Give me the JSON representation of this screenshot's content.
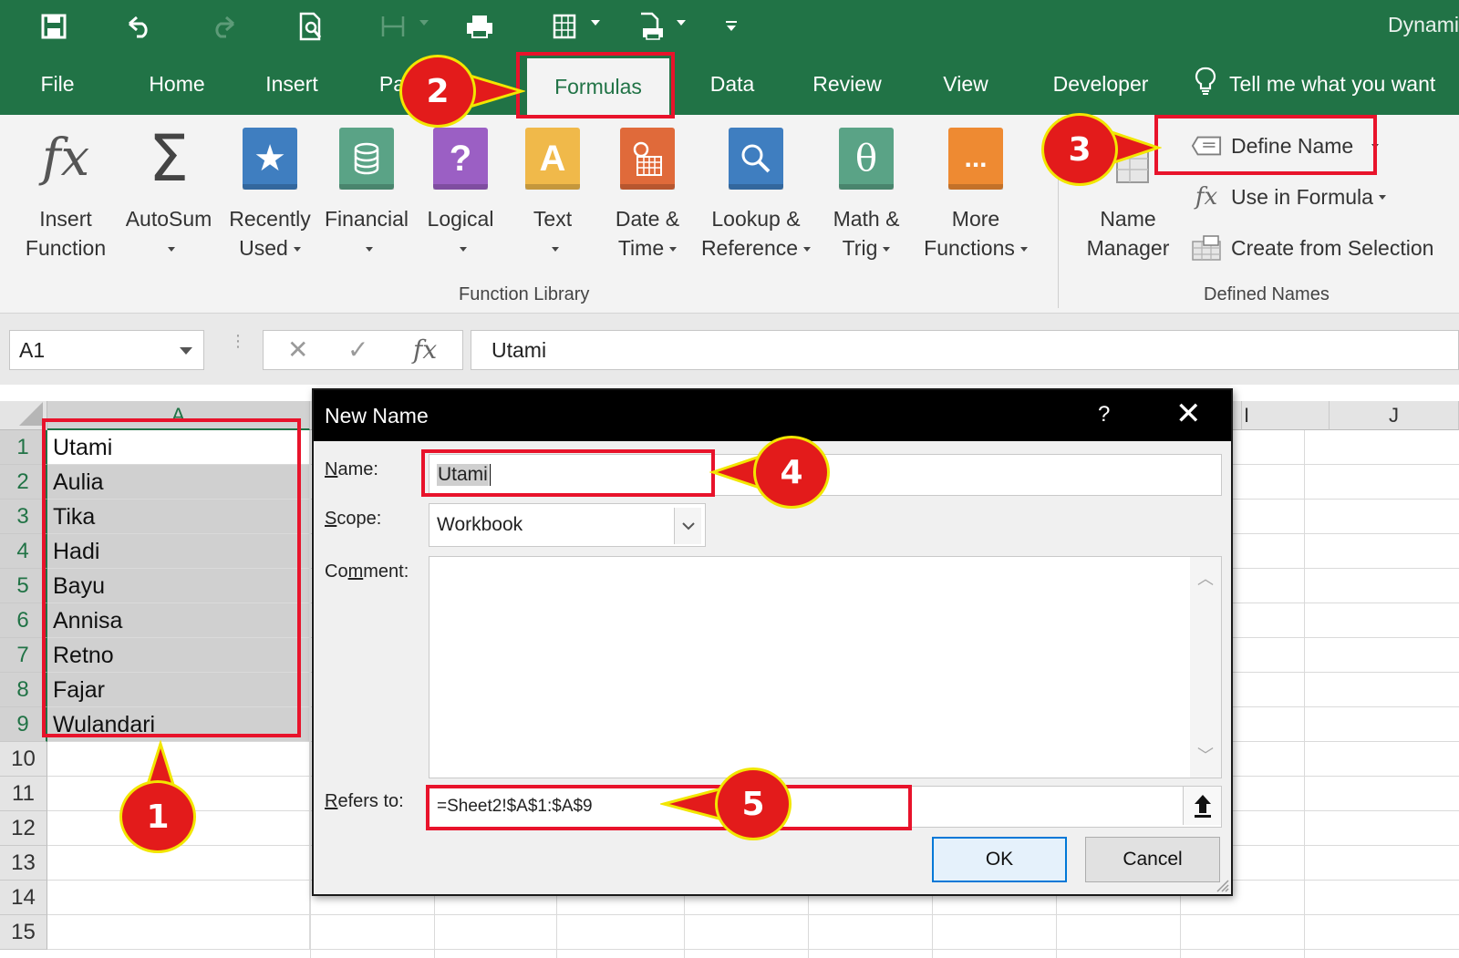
{
  "app": {
    "title": "Dynami"
  },
  "quick_access": {
    "icons": [
      "save-icon",
      "undo-icon",
      "redo-icon",
      "print-preview-icon",
      "freeze-icon",
      "print-icon",
      "page-setup-icon",
      "print-area-icon",
      "customize-icon"
    ]
  },
  "tabs": [
    "File",
    "Home",
    "Insert",
    "Pa",
    "Formulas",
    "Data",
    "Review",
    "View",
    "Developer"
  ],
  "tell_me": "Tell me what you want",
  "ribbon": {
    "function_library": {
      "label": "Function Library",
      "buttons": [
        {
          "line1": "Insert",
          "line2": "Function"
        },
        {
          "line1": "AutoSum",
          "line2": ""
        },
        {
          "line1": "Recently",
          "line2": "Used"
        },
        {
          "line1": "Financial",
          "line2": ""
        },
        {
          "line1": "Logical",
          "line2": ""
        },
        {
          "line1": "Text",
          "line2": ""
        },
        {
          "line1": "Date &",
          "line2": "Time"
        },
        {
          "line1": "Lookup &",
          "line2": "Reference"
        },
        {
          "line1": "Math &",
          "line2": "Trig"
        },
        {
          "line1": "More",
          "line2": "Functions"
        }
      ],
      "icon_text": {
        "insert": "fx",
        "autosum": "Σ",
        "logical": "?",
        "text": "A",
        "math": "θ",
        "more": "..."
      },
      "icon_colors": {
        "recently": "#3f7ec0",
        "financial": "#5aa386",
        "logical": "#9b5fc4",
        "text": "#f0b94a",
        "date": "#e06a3a",
        "lookup": "#3f7ec0",
        "math": "#5aa386",
        "more": "#ee8a32"
      }
    },
    "defined_names": {
      "label": "Defined Names",
      "name_manager": {
        "line1": "Name",
        "line2": "Manager"
      },
      "define_name": "Define Name",
      "use_in_formula": "Use in Formula",
      "create_from_selection": "Create from Selection"
    }
  },
  "formula_bar": {
    "name_box": "A1",
    "fx": "fx",
    "value": "Utami"
  },
  "grid": {
    "columns": [
      "A",
      "I",
      "J"
    ],
    "rows": [
      "1",
      "2",
      "3",
      "4",
      "5",
      "6",
      "7",
      "8",
      "9",
      "10",
      "11",
      "12",
      "13",
      "14",
      "15"
    ],
    "column_a": [
      "Utami",
      "Aulia",
      "Tika",
      "Hadi",
      "Bayu",
      "Annisa",
      "Retno",
      "Fajar",
      "Wulandari"
    ]
  },
  "dialog": {
    "title": "New Name",
    "help": "?",
    "name_label": {
      "accel": "N",
      "rest": "ame:"
    },
    "name_value": "Utami",
    "scope_label": {
      "accel": "S",
      "rest": "cope:"
    },
    "scope_value": "Workbook",
    "comment_label": {
      "pre": "Co",
      "accel": "m",
      "rest": "ment:"
    },
    "refers_label": {
      "accel": "R",
      "rest": "efers to:"
    },
    "refers_value": "=Sheet2!$A$1:$A$9",
    "ok": "OK",
    "cancel": "Cancel"
  },
  "annotations": [
    "1",
    "2",
    "3",
    "4",
    "5"
  ],
  "colors": {
    "excel_green": "#217346",
    "highlight_red": "#e8132b",
    "badge_red": "#e31b1b",
    "badge_yellow": "#f2e600"
  }
}
